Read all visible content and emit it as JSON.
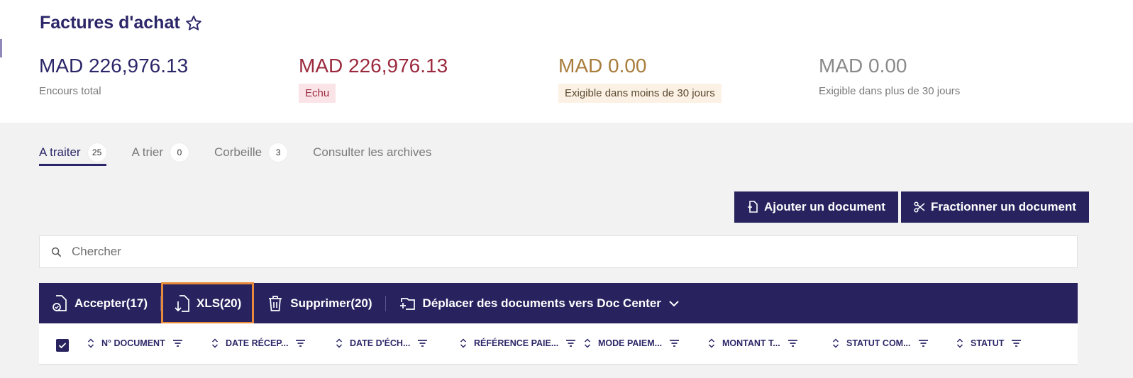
{
  "header": {
    "title": "Factures d'achat"
  },
  "kpis": [
    {
      "amount": "MAD 226,976.13",
      "label": "Encours total",
      "color": "#2c2768"
    },
    {
      "amount": "MAD 226,976.13",
      "label": "Echu",
      "color": "#9b2a3e",
      "badge_bg": "#fbe4e8"
    },
    {
      "amount": "MAD 0.00",
      "label": "Exigible dans moins de 30 jours",
      "color": "#a87c3b",
      "badge_bg": "#fbf1e4"
    },
    {
      "amount": "MAD 0.00",
      "label": "Exigible dans plus de 30 jours",
      "color": "#7a7a7a"
    }
  ],
  "tabs": [
    {
      "label": "A traiter",
      "count": "25",
      "active": true
    },
    {
      "label": "A trier",
      "count": "0"
    },
    {
      "label": "Corbeille",
      "count": "3"
    },
    {
      "label": "Consulter les archives"
    }
  ],
  "buttons": {
    "add_document": "Ajouter un document",
    "split_document": "Fractionner un document"
  },
  "search": {
    "placeholder": "Chercher",
    "value": ""
  },
  "actions": {
    "accept": "Accepter(17)",
    "xls": "XLS(20)",
    "delete": "Supprimer(20)",
    "move": "Déplacer des documents vers Doc Center"
  },
  "table": {
    "columns": [
      "N° DOCUMENT",
      "DATE RÉCEP...",
      "DATE D'ÉCH...",
      "RÉFÉRENCE PAIE...",
      "MODE PAIEM...",
      "MONTANT T...",
      "STATUT COM...",
      "STATUT"
    ]
  },
  "colors": {
    "primary": "#28235f",
    "highlight": "#e8893c"
  }
}
